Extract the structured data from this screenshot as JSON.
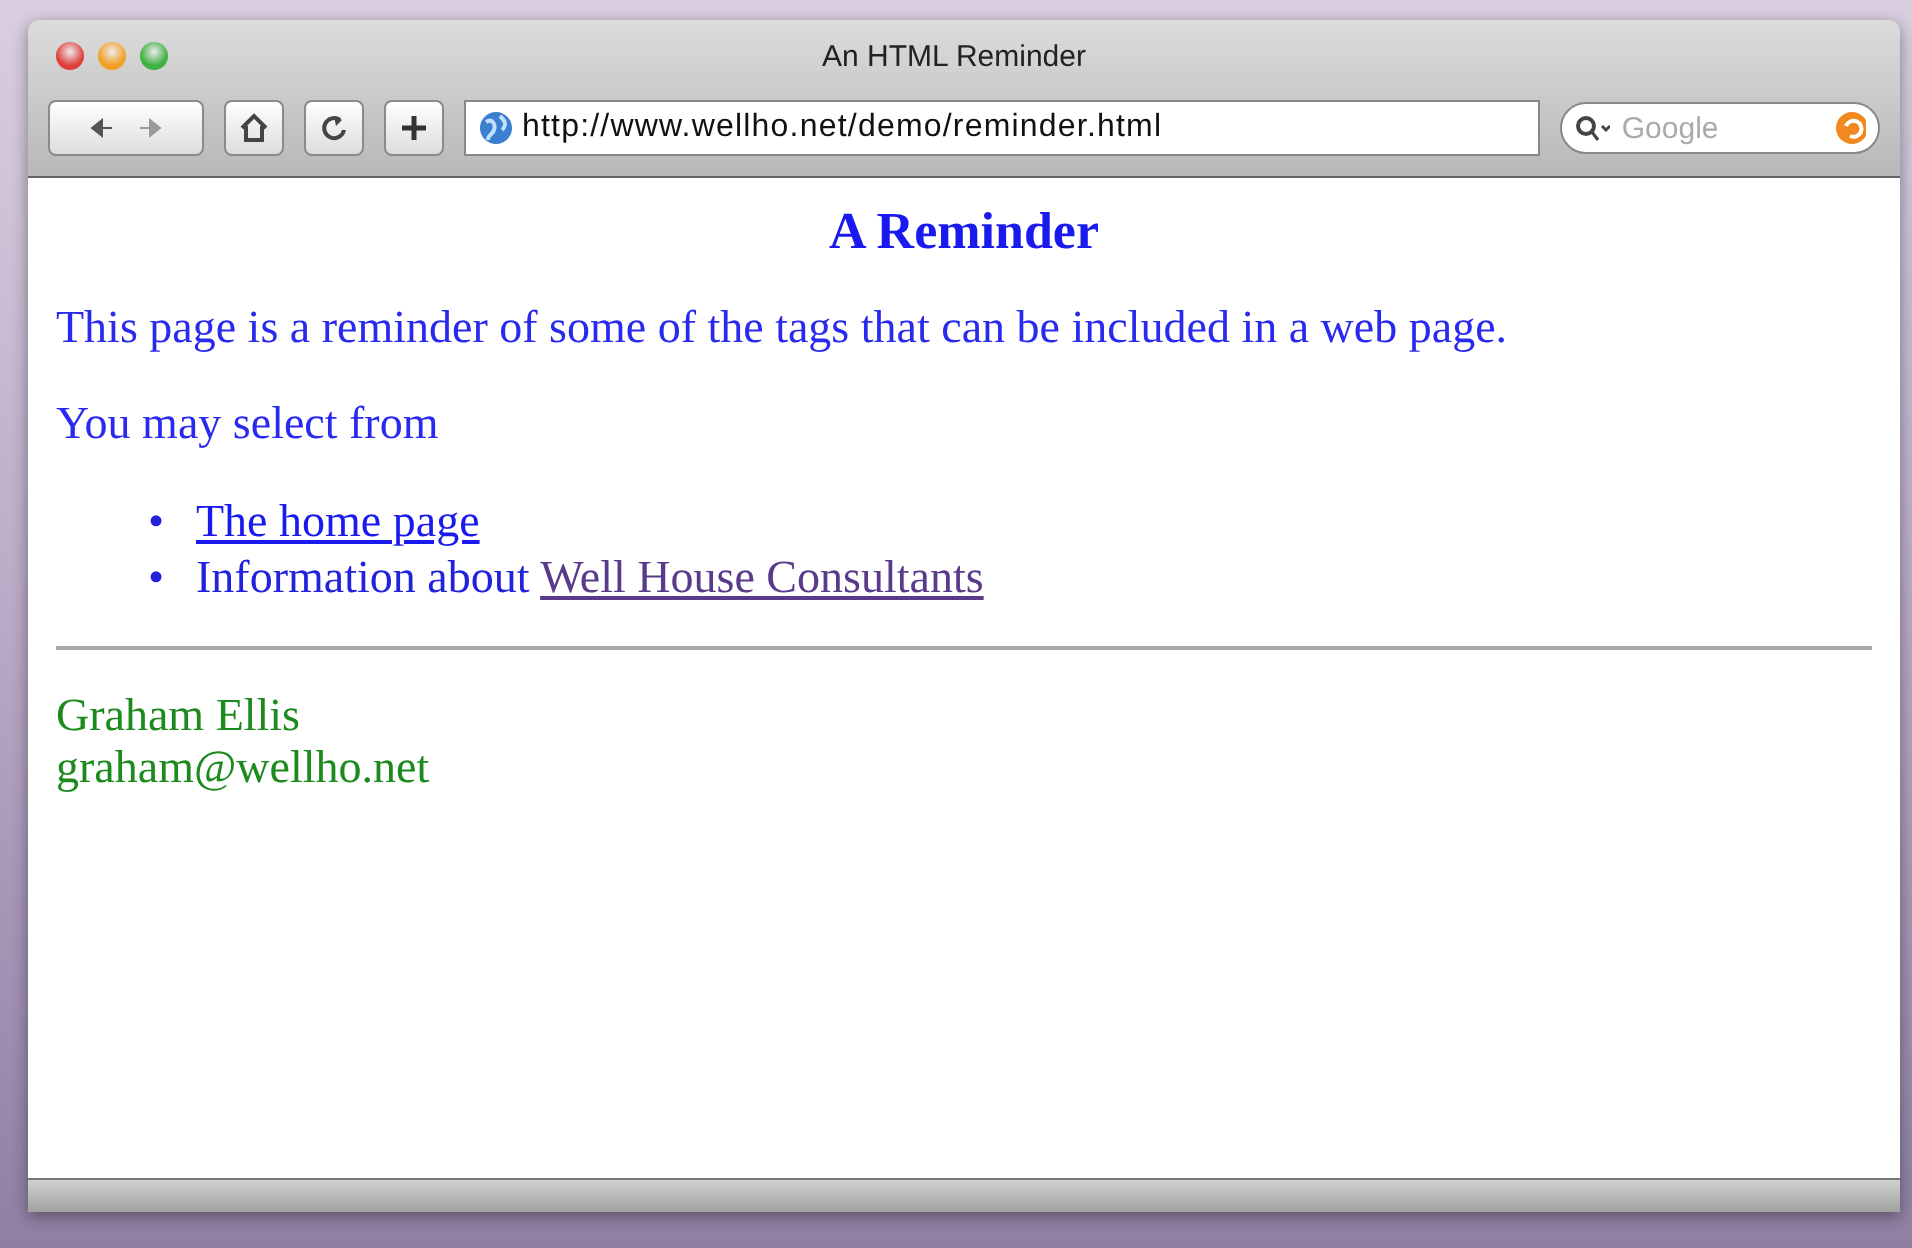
{
  "window": {
    "title": "An HTML Reminder"
  },
  "toolbar": {
    "address": "http://www.wellho.net/demo/reminder.html",
    "search": {
      "placeholder": "Google"
    }
  },
  "page": {
    "heading": "A Reminder",
    "paragraphs": [
      "This page is a reminder of some of the tags that can be included in a web page.",
      "You may select from"
    ],
    "list": [
      {
        "marker": "•",
        "link": {
          "label": "The home page",
          "visited": false
        }
      },
      {
        "marker": "•",
        "text": "Information about",
        "link": {
          "label": "Well House Consultants",
          "visited": true
        }
      }
    ],
    "footer": [
      "Graham Ellis",
      "graham@wellho.net"
    ]
  }
}
